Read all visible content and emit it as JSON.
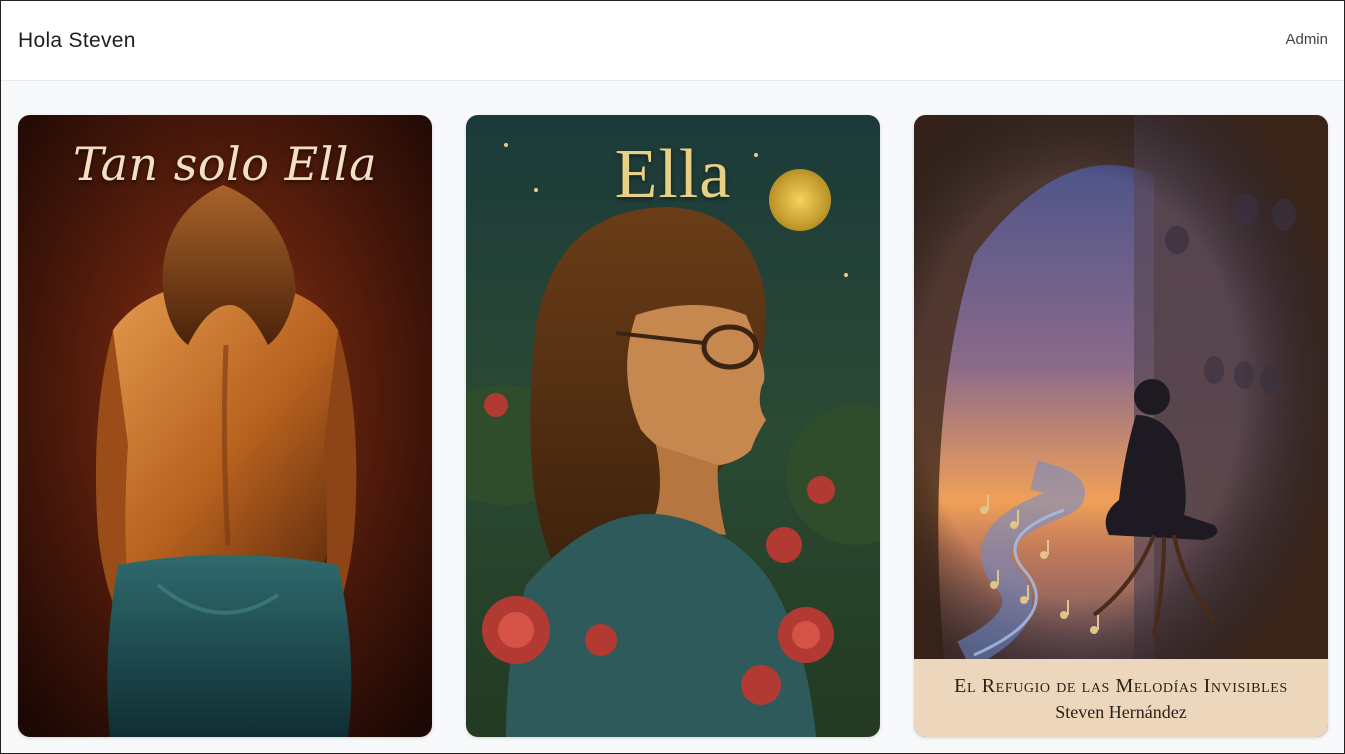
{
  "header": {
    "greeting": "Hola Steven",
    "admin_label": "Admin"
  },
  "books": [
    {
      "cover_title": "Tan solo Ella"
    },
    {
      "cover_title": "Ella"
    },
    {
      "cover_title": "El Refugio de las Melodías Invisibles",
      "cover_author": "Steven Hernández"
    }
  ],
  "colors": {
    "page_background": "#f7f8fa",
    "header_background": "#ffffff",
    "banner_background": "#ecd6bc"
  }
}
